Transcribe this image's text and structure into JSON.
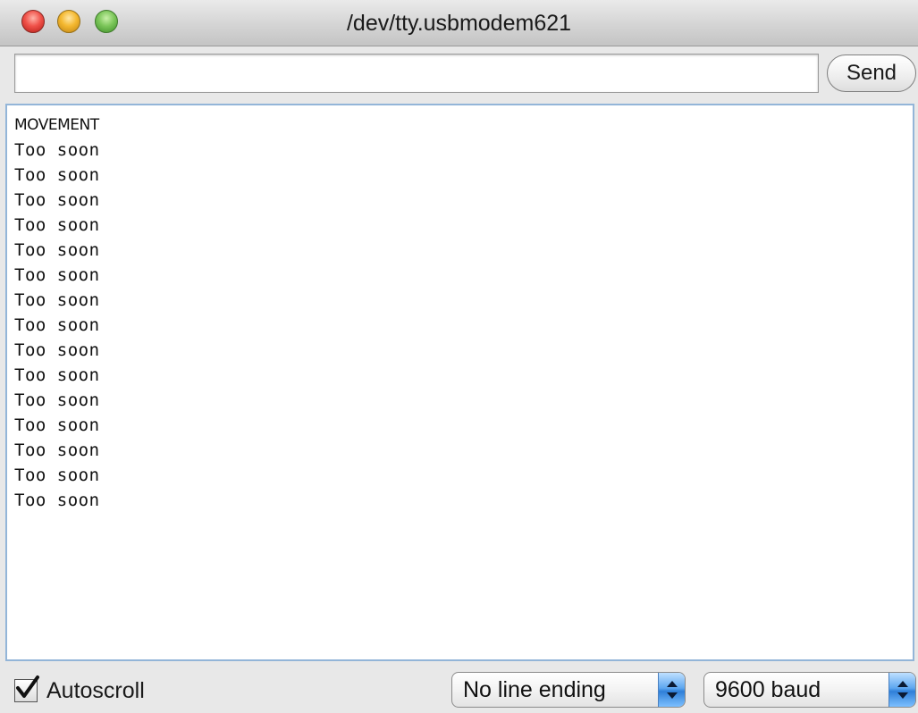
{
  "window": {
    "title": "/dev/tty.usbmodem621"
  },
  "input": {
    "value": "",
    "placeholder": ""
  },
  "send_button": {
    "label": "Send"
  },
  "output": {
    "lines": [
      "MOVEMENT",
      "Too soon",
      "Too soon",
      "Too soon",
      "Too soon",
      "Too soon",
      "Too soon",
      "Too soon",
      "Too soon",
      "Too soon",
      "Too soon",
      "Too soon",
      "Too soon",
      "Too soon",
      "Too soon",
      "Too soon"
    ]
  },
  "footer": {
    "autoscroll_label": "Autoscroll",
    "autoscroll_checked": true,
    "line_ending_value": "No line ending",
    "baud_value": "9600 baud"
  },
  "colors": {
    "output_border": "#93b5d8",
    "popup_arrow_accent": "#2f7fd8"
  },
  "icons": {
    "close": "close-icon",
    "minimize": "minimize-icon",
    "zoom": "zoom-icon",
    "checkmark": "checkmark-icon",
    "popup_arrows": "updown-arrows-icon"
  }
}
